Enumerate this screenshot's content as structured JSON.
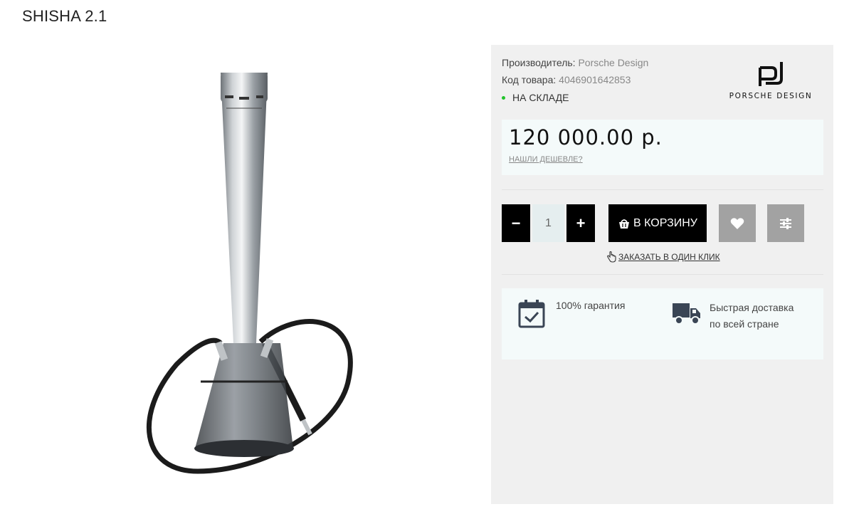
{
  "product": {
    "title": "SHISHA 2.1"
  },
  "info": {
    "manufacturer_label": "Производитель:",
    "manufacturer_value": "Porsche Design",
    "sku_label": "Код товара:",
    "sku_value": "4046901642853",
    "stock_status": "НА СКЛАДЕ"
  },
  "brand": {
    "logo_text": "PORSCHE DESIGN"
  },
  "price": {
    "amount": "120 000.00 р.",
    "cheaper_link": "НАШЛИ ДЕШЕВЛЕ?"
  },
  "cart": {
    "minus": "−",
    "plus": "+",
    "quantity": "1",
    "add_to_cart": "В КОРЗИНУ",
    "one_click": "ЗАКАЗАТЬ В ОДИН КЛИК"
  },
  "features": {
    "guarantee": "100% гарантия",
    "delivery_line1": "Быстрая доставка",
    "delivery_line2": "по всей стране"
  },
  "colors": {
    "panel_bg": "#f0f0f0",
    "price_bg": "#f4fafa",
    "primary_button": "#000000",
    "secondary_button": "#a2a2a2",
    "stock_dot": "#22c32b",
    "qty_bg": "#e5eeef"
  },
  "icons": {
    "cart": "basket-icon",
    "favorite": "heart-icon",
    "compare": "sliders-icon",
    "one_click": "hand-pointer-icon",
    "guarantee": "calendar-check-icon",
    "delivery": "truck-icon"
  }
}
